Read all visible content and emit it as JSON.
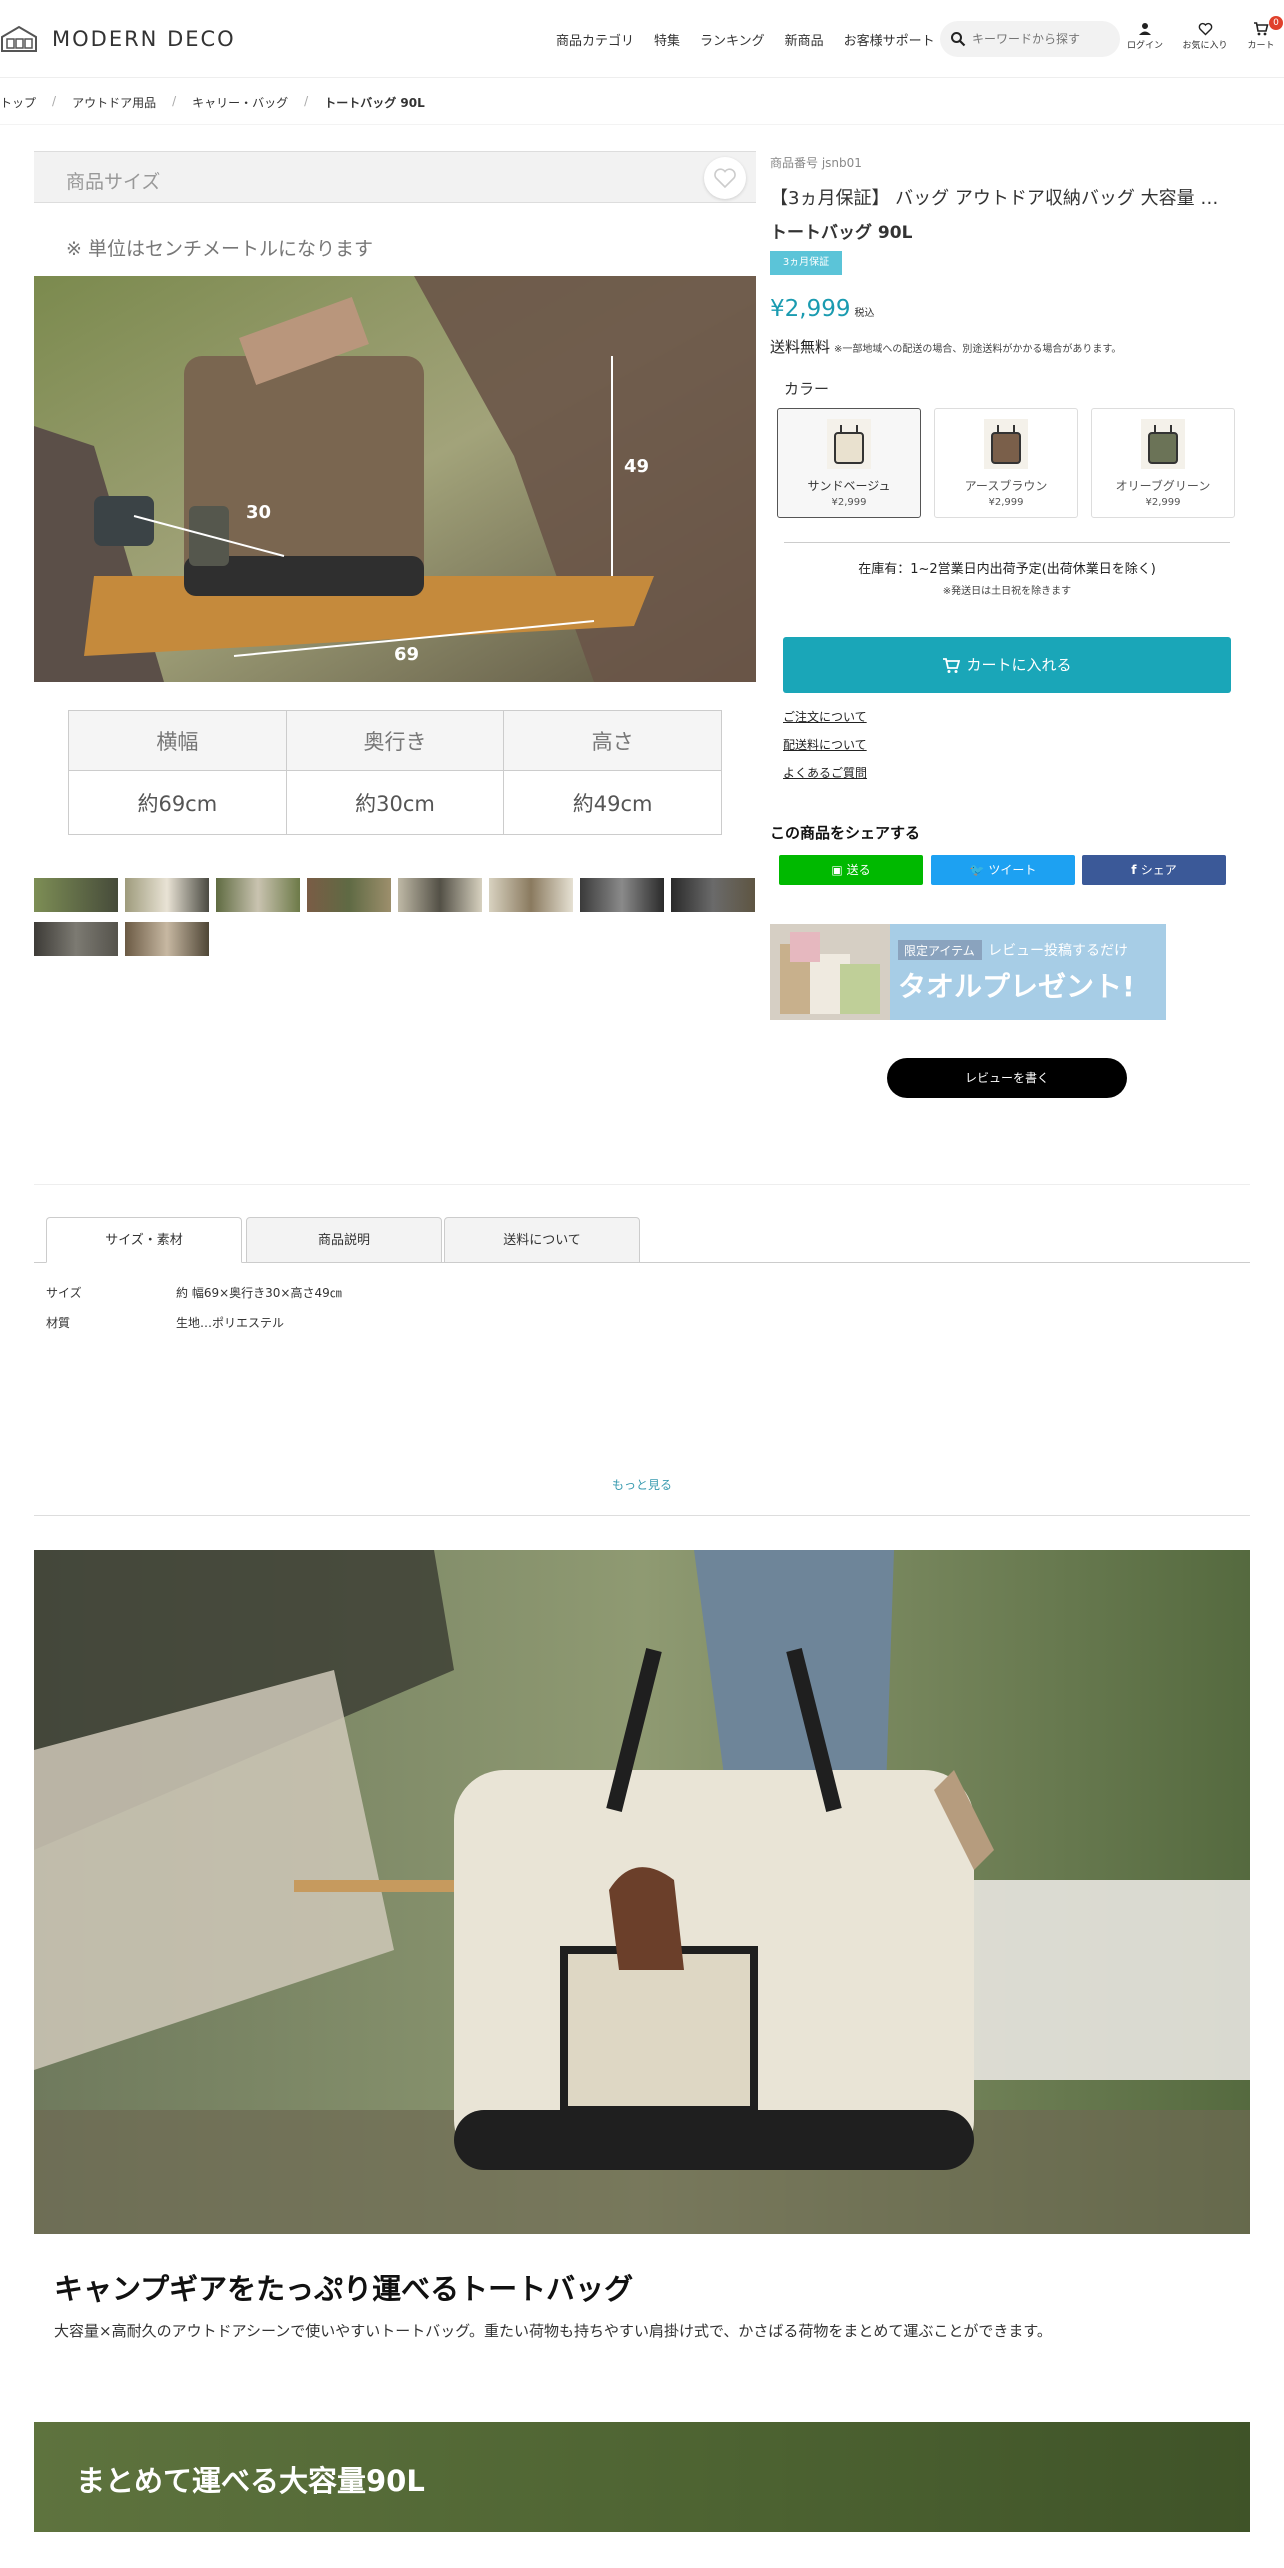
{
  "header": {
    "logo_text": "MODERN DECO",
    "nav": [
      "商品カテゴリ",
      "特集",
      "ランキング",
      "新商品",
      "お客様サポート"
    ],
    "search_placeholder": "キーワードから探す",
    "login_label": "ログイン",
    "favorites_label": "お気に入り",
    "cart_label": "カート",
    "cart_count": "0"
  },
  "breadcrumb": [
    "トップ",
    "アウトドア用品",
    "キャリー・バッグ",
    "トートバッグ 90L"
  ],
  "gallery": {
    "size_heading": "商品サイズ",
    "unit_note": "※ 単位はセンチメートルになります",
    "photo_labels": {
      "depth": "30",
      "height": "49",
      "width": "69"
    },
    "dim_headers": [
      "横幅",
      "奥行き",
      "高さ"
    ],
    "dim_values": [
      "約69cm",
      "約30cm",
      "約49cm"
    ]
  },
  "product": {
    "number": "商品番号 jsnb01",
    "name_line1": "【3ヵ月保証】 バッグ アウトドア収納バッグ 大容量 …",
    "name_line2": "トートバッグ 90L",
    "tag": "3ヵ月保証",
    "price": "¥2,999",
    "tax_label": "税込",
    "shipping_title": "送料無料",
    "shipping_note": "※一部地域への配送の場合、別途送料がかかる場合があります。",
    "color_label": "カラー",
    "colors": [
      {
        "name": "サンドベージュ",
        "price": "¥2,999"
      },
      {
        "name": "アースブラウン",
        "price": "¥2,999"
      },
      {
        "name": "オリーブグリーン",
        "price": "¥2,999"
      }
    ],
    "stock": "在庫有：1~2営業日内出荷予定(出荷休業日を除く)",
    "stock_note": "※発送日は土日祝を除きます",
    "cart_button": "カートに入れる",
    "links": [
      "ご注文について",
      "配送料について",
      "よくあるご質問"
    ],
    "share_title": "この商品をシェアする",
    "share": {
      "line": "送る",
      "twitter": "ツイート",
      "facebook": "シェア"
    },
    "banner": {
      "badge": "限定アイテム",
      "line1": "レビュー投稿するだけ",
      "line2": "タオルプレゼント!"
    },
    "review_button": "レビューを書く"
  },
  "tabs": {
    "items": [
      "サイズ・素材",
      "商品説明",
      "送料について"
    ],
    "specs": [
      {
        "key": "サイズ",
        "value": "約 幅69×奥行き30×高さ49㎝"
      },
      {
        "key": "材質",
        "value": "生地…ポリエステル"
      }
    ],
    "more": "もっと見る"
  },
  "feature": {
    "title": "キャンプギアをたっぷり運べるトートバッグ",
    "desc": "大容量×高耐久のアウトドアシーンで使いやすいトートバッグ。重たい荷物も持ちやすい肩掛け式で、かさばる荷物をまとめて運ぶことができます。",
    "banner": "まとめて運べる大容量90L"
  },
  "colors": {
    "accent": "#1aa6b8",
    "price": "#1a9bb0",
    "line": "#00b900",
    "twitter": "#1da1f2",
    "facebook": "#3b5998",
    "tag": "#5bc4d8",
    "green": "#4c6231"
  }
}
